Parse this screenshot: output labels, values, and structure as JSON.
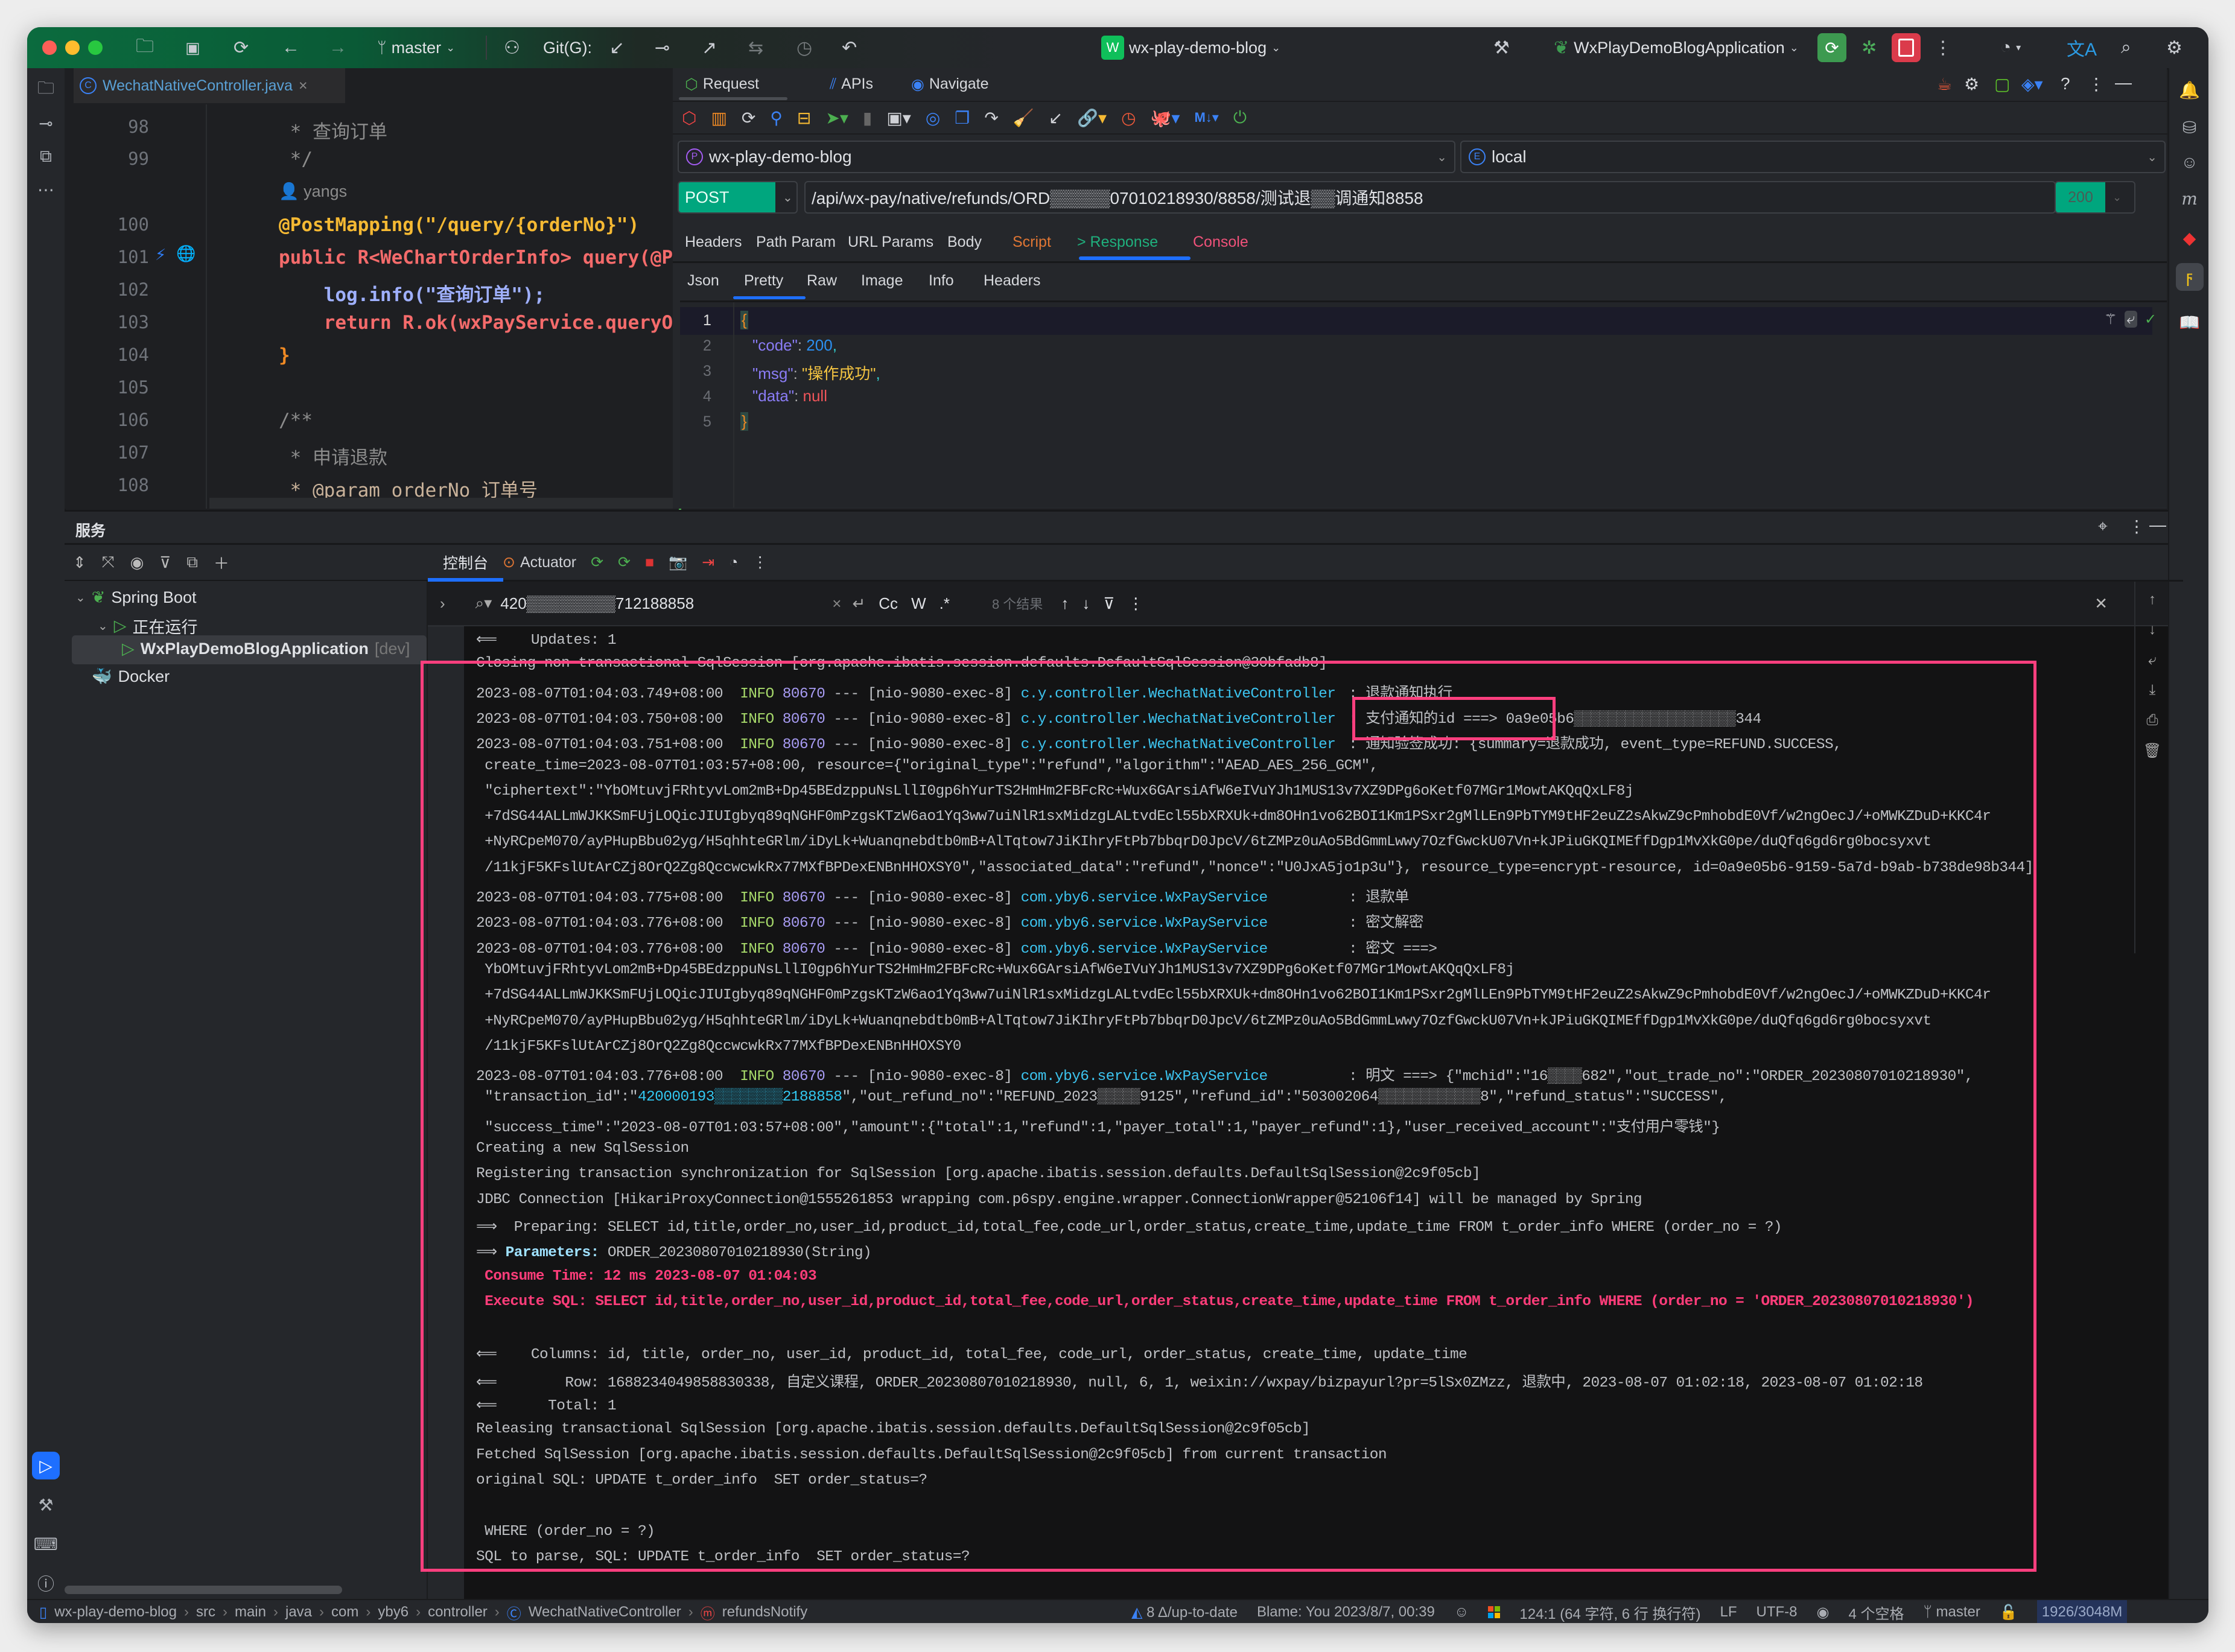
{
  "titlebar": {
    "branch": "master",
    "git_label": "Git(G):",
    "project_badge": "W",
    "project_name": "wx-play-demo-blog",
    "run_config": "WxPlayDemoBlogApplication",
    "colors": {
      "accent_green": "#0fbf5a",
      "run_green": "#3d9a50",
      "stop_red": "#db3b4b"
    }
  },
  "editor": {
    "tab_label": "WechatNativeController.java",
    "author_hint": "yangs",
    "lines": [
      {
        "num": "98",
        "text": " * 查询订单"
      },
      {
        "num": "99",
        "text": " */"
      },
      {
        "num": "100",
        "text": "@PostMapping(\"/query/{orderNo}\")"
      },
      {
        "num": "101",
        "text": "public R<WeChartOrderInfo> query(@Pat"
      },
      {
        "num": "102",
        "text": "    log.info(\"查询订单\");"
      },
      {
        "num": "103",
        "text": "    return R.ok(wxPayService.queryOrd"
      },
      {
        "num": "104",
        "text": "}"
      },
      {
        "num": "105",
        "text": ""
      },
      {
        "num": "106",
        "text": "/**"
      },
      {
        "num": "107",
        "text": " * 申请退款"
      },
      {
        "num": "108",
        "text": " * @param orderNo 订单号"
      }
    ]
  },
  "request_panel": {
    "tabs": [
      "Request",
      "APIs",
      "Navigate"
    ],
    "module": "wx-play-demo-blog",
    "environment": "local",
    "method": "POST",
    "url": "/api/wx-pay/native/refunds/ORD▒▒▒▒▒07010218930/8858/测试退▒▒调通知8858",
    "status_code": "200",
    "request_tabs": [
      "Headers",
      "Path Param",
      "URL Params",
      "Body",
      "Script",
      "> Response",
      "Console"
    ],
    "active_request_tab": "> Response",
    "response_tabs": [
      "Json",
      "Pretty",
      "Raw",
      "Image",
      "Info",
      "Headers"
    ],
    "active_response_tab": "Pretty",
    "response_lines": [
      "1",
      "2",
      "3",
      "4",
      "5"
    ],
    "response": {
      "code_key": "\"code\"",
      "code_val": "200",
      "msg_key": "\"msg\"",
      "msg_val": "\"操作成功\"",
      "data_key": "\"data\"",
      "data_val": "null"
    }
  },
  "services": {
    "title": "服务",
    "tree": {
      "spring_boot": "Spring Boot",
      "running": "正在运行",
      "app": "WxPlayDemoBlogApplication",
      "app_suffix": "[dev]",
      "docker": "Docker"
    },
    "console_tab": "控制台",
    "actuator_tab": "Actuator",
    "search_value": "420▒▒▒▒▒▒▒▒712188858",
    "search_opts": [
      "Cc",
      "W",
      ".*"
    ],
    "result_count": "8 个结果"
  },
  "console": {
    "lines": [
      {
        "t": "plain",
        "text": "⟸    Updates: 1"
      },
      {
        "t": "plain",
        "text": "Closing non transactional SqlSession [org.apache.ibatis.session.defaults.DefaultSqlSession@30bfadb8]"
      },
      {
        "t": "log",
        "ts": "2023-08-07T01:04:03.749+08:00",
        "lv": "INFO",
        "pid": "80670",
        "th": "--- [nio-9080-exec-8]",
        "cls": "c.y.controller.WechatNativeController",
        "msg": ": 退款通知执行"
      },
      {
        "t": "log",
        "ts": "2023-08-07T01:04:03.750+08:00",
        "lv": "INFO",
        "pid": "80670",
        "th": "--- [nio-9080-exec-8]",
        "cls": "c.y.controller.WechatNativeController",
        "msg": ": 支付通知的id ===> 0a9e05b6▒▒▒▒▒▒▒▒▒▒▒▒▒▒▒▒▒▒▒344"
      },
      {
        "t": "log",
        "ts": "2023-08-07T01:04:03.751+08:00",
        "lv": "INFO",
        "pid": "80670",
        "th": "--- [nio-9080-exec-8]",
        "cls": "c.y.controller.WechatNativeController",
        "msg": ": 通知验签成功: {summary=退款成功, event_type=REFUND.SUCCESS,"
      },
      {
        "t": "plain",
        "text": " create_time=2023-08-07T01:03:57+08:00, resource={\"original_type\":\"refund\",\"algorithm\":\"AEAD_AES_256_GCM\","
      },
      {
        "t": "plain",
        "text": " \"ciphertext\":\"YbOMtuvjFRhtyvLom2mB+Dp45BEdzppuNsLllI0gp6hYurTS2HmHm2FBFcRc+Wux6GArsiAfW6eIVuYJh1MUS13v7XZ9DPg6oKetf07MGr1MowtAKQqQxLF8j"
      },
      {
        "t": "plain",
        "text": " +7dSG44ALLmWJKKSmFUjLOQicJIUIgbyq89qNGHF0mPzgsKTzW6ao1Yq3ww7uiNlR1sxMidzgLALtvdEcl55bXRXUk+dm8OHn1vo62BOI1Km1PSxr2gMlLEn9PbTYM9tHF2euZ2sAkwZ9cPmhobdE0Vf/w2ngOecJ/+oMWKZDuD+KKC4r"
      },
      {
        "t": "plain",
        "text": " +NyRCpeM070/ayPHupBbu02yg/H5qhhteGRlm/iDyLk+Wuanqnebdtb0mB+AlTqtow7JiKIhryFtPb7bbqrD0JpcV/6tZMPz0uAo5BdGmmLwwy7OzfGwckU07Vn+kJPiuGKQIMEffDgp1MvXkG0pe/duQfq6gd6rg0bocsyxvt"
      },
      {
        "t": "plain",
        "text": " /11kjF5KFslUtArCZj8OrQ2Zg8QccwcwkRx77MXfBPDexENBnHHOXSY0\",\"associated_data\":\"refund\",\"nonce\":\"U0JxA5jo1p3u\"}, resource_type=encrypt-resource, id=0a9e05b6-9159-5a7d-b9ab-b738de98b344]"
      },
      {
        "t": "log",
        "ts": "2023-08-07T01:04:03.775+08:00",
        "lv": "INFO",
        "pid": "80670",
        "th": "--- [nio-9080-exec-8]",
        "cls": "com.yby6.service.WxPayService",
        "msg": ": 退款单"
      },
      {
        "t": "log",
        "ts": "2023-08-07T01:04:03.776+08:00",
        "lv": "INFO",
        "pid": "80670",
        "th": "--- [nio-9080-exec-8]",
        "cls": "com.yby6.service.WxPayService",
        "msg": ": 密文解密"
      },
      {
        "t": "log",
        "ts": "2023-08-07T01:04:03.776+08:00",
        "lv": "INFO",
        "pid": "80670",
        "th": "--- [nio-9080-exec-8]",
        "cls": "com.yby6.service.WxPayService",
        "msg": ": 密文 ===>"
      },
      {
        "t": "plain",
        "text": " YbOMtuvjFRhtyvLom2mB+Dp45BEdzppuNsLllI0gp6hYurTS2HmHm2FBFcRc+Wux6GArsiAfW6eIVuYJh1MUS13v7XZ9DPg6oKetf07MGr1MowtAKQqQxLF8j"
      },
      {
        "t": "plain",
        "text": " +7dSG44ALLmWJKKSmFUjLOQicJIUIgbyq89qNGHF0mPzgsKTzW6ao1Yq3ww7uiNlR1sxMidzgLALtvdEcl55bXRXUk+dm8OHn1vo62BOI1Km1PSxr2gMlLEn9PbTYM9tHF2euZ2sAkwZ9cPmhobdE0Vf/w2ngOecJ/+oMWKZDuD+KKC4r"
      },
      {
        "t": "plain",
        "text": " +NyRCpeM070/ayPHupBbu02yg/H5qhhteGRlm/iDyLk+Wuanqnebdtb0mB+AlTqtow7JiKIhryFtPb7bbqrD0JpcV/6tZMPz0uAo5BdGmmLwwy7OzfGwckU07Vn+kJPiuGKQIMEffDgp1MvXkG0pe/duQfq6gd6rg0bocsyxvt"
      },
      {
        "t": "plain",
        "text": " /11kjF5KFslUtArCZj8OrQ2Zg8QccwcwkRx77MXfBPDexENBnHHOXSY0"
      },
      {
        "t": "log",
        "ts": "2023-08-07T01:04:03.776+08:00",
        "lv": "INFO",
        "pid": "80670",
        "th": "--- [nio-9080-exec-8]",
        "cls": "com.yby6.service.WxPayService",
        "msg": ": 明文 ===> {\"mchid\":\"16▒▒▒▒682\",\"out_trade_no\":\"ORDER_20230807010218930\","
      },
      {
        "t": "txn",
        "pre": " \"transaction_id\":\"",
        "hl": "420000193▒▒▒▒▒▒▒▒2188858",
        "post": "\",\"out_refund_no\":\"REFUND_2023▒▒▒▒▒9125\",\"refund_id\":\"503002064▒▒▒▒▒▒▒▒▒▒▒▒8\",\"refund_status\":\"SUCCESS\","
      },
      {
        "t": "plain",
        "text": " \"success_time\":\"2023-08-07T01:03:57+08:00\",\"amount\":{\"total\":1,\"refund\":1,\"payer_total\":1,\"payer_refund\":1},\"user_received_account\":\"支付用户零钱\"}"
      },
      {
        "t": "plain",
        "text": "Creating a new SqlSession"
      },
      {
        "t": "plain",
        "text": "Registering transaction synchronization for SqlSession [org.apache.ibatis.session.defaults.DefaultSqlSession@2c9f05cb]"
      },
      {
        "t": "plain",
        "text": "JDBC Connection [HikariProxyConnection@1555261853 wrapping com.p6spy.engine.wrapper.ConnectionWrapper@52106f14] will be managed by Spring"
      },
      {
        "t": "plain",
        "text": "⟹  Preparing: SELECT id,title,order_no,user_id,product_id,total_fee,code_url,order_status,create_time,update_time FROM t_order_info WHERE (order_no = ?)"
      },
      {
        "t": "param",
        "arrow": "⟹ ",
        "label": "Parameters:",
        "text": " ORDER_20230807010218930(String)"
      },
      {
        "t": "red",
        "text": " Consume Time: 12 ms 2023-08-07 01:04:03"
      },
      {
        "t": "red",
        "text": " Execute SQL: SELECT id,title,order_no,user_id,product_id,total_fee,code_url,order_status,create_time,update_time FROM t_order_info WHERE (order_no = 'ORDER_20230807010218930')"
      },
      {
        "t": "plain",
        "text": ""
      },
      {
        "t": "plain",
        "text": "⟸    Columns: id, title, order_no, user_id, product_id, total_fee, code_url, order_status, create_time, update_time"
      },
      {
        "t": "plain",
        "text": "⟸        Row: 1688234049858830338, 自定义课程, ORDER_20230807010218930, null, 6, 1, weixin://wxpay/bizpayurl?pr=5lSx0ZMzz, 退款中, 2023-08-07 01:02:18, 2023-08-07 01:02:18"
      },
      {
        "t": "plain",
        "text": "⟸      Total: 1"
      },
      {
        "t": "plain",
        "text": "Releasing transactional SqlSession [org.apache.ibatis.session.defaults.DefaultSqlSession@2c9f05cb]"
      },
      {
        "t": "plain",
        "text": "Fetched SqlSession [org.apache.ibatis.session.defaults.DefaultSqlSession@2c9f05cb] from current transaction"
      },
      {
        "t": "plain",
        "text": "original SQL: UPDATE t_order_info  SET order_status=?"
      },
      {
        "t": "plain",
        "text": ""
      },
      {
        "t": "plain",
        "text": " WHERE (order_no = ?)"
      },
      {
        "t": "plain",
        "text": "SQL to parse, SQL: UPDATE t_order_info  SET order_status=?"
      }
    ],
    "highlight_color": "#ff3f7e"
  },
  "statusbar": {
    "breadcrumbs": [
      "wx-play-demo-blog",
      "src",
      "main",
      "java",
      "com",
      "yby6",
      "controller",
      "WechatNativeController",
      "refundsNotify"
    ],
    "vcs": "8 Δ/up-to-date",
    "blame": "Blame: You 2023/8/7, 00:39",
    "position": "124:1 (64 字符, 6 行 换行符)",
    "line_sep": "LF",
    "encoding": "UTF-8",
    "indent": "4 个空格",
    "branch": "master",
    "memory": "1926/3048M"
  }
}
